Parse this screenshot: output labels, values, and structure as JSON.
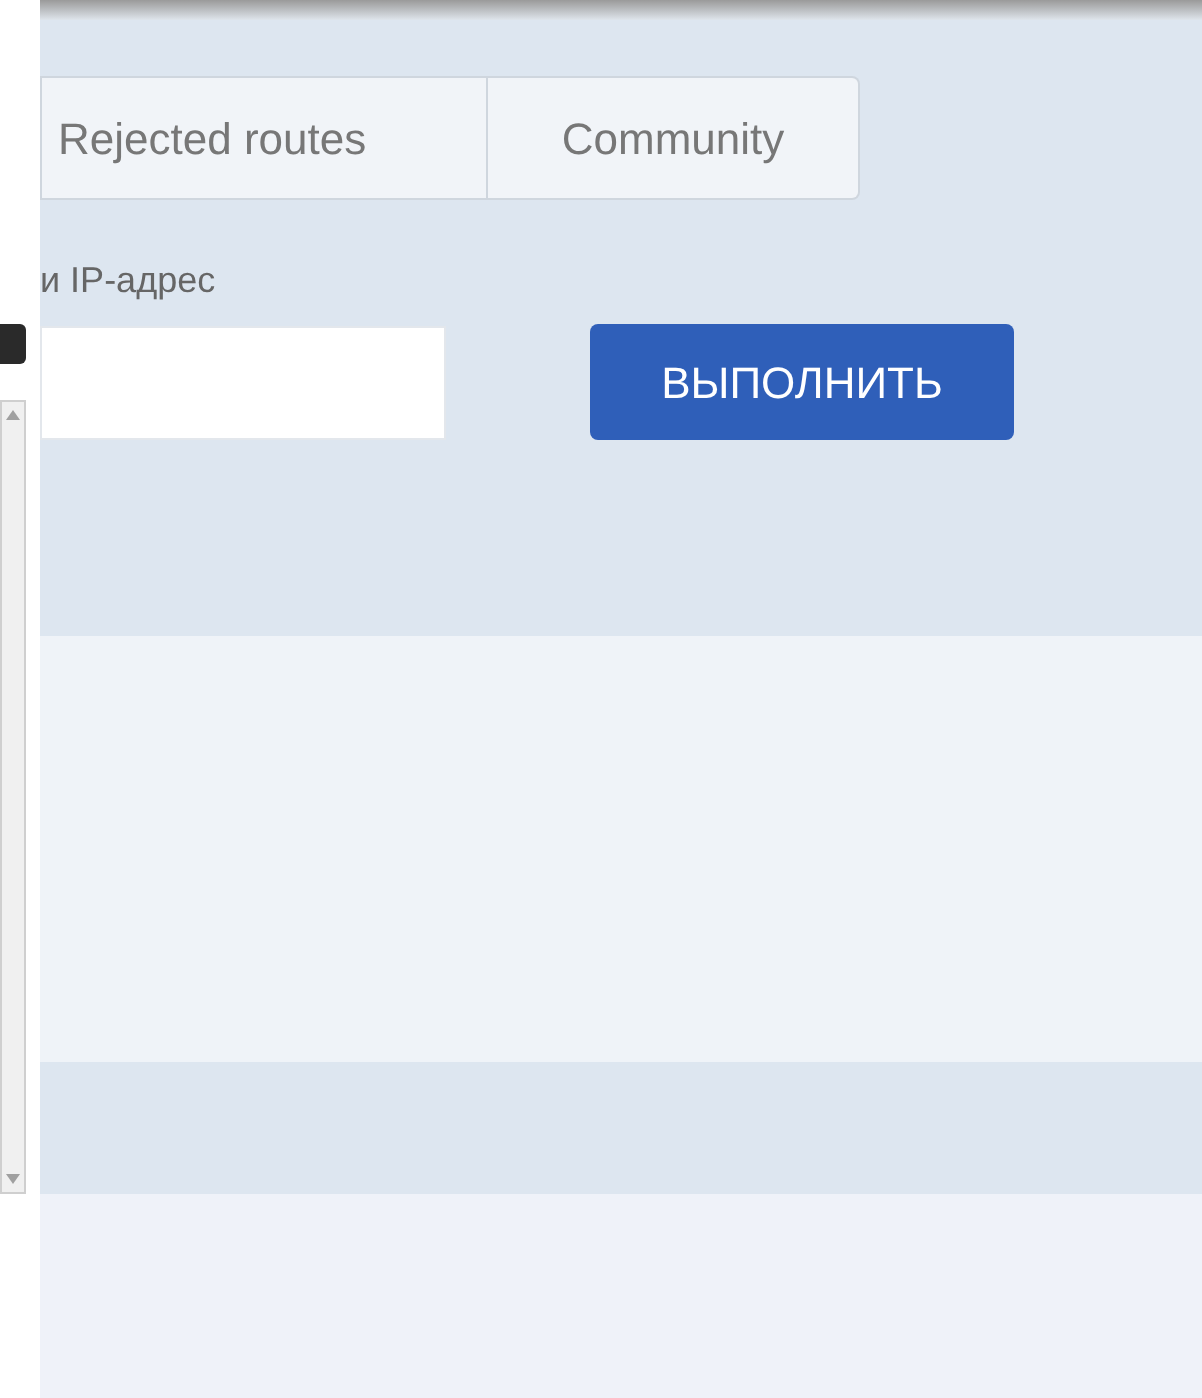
{
  "tabs": [
    {
      "label": "Rejected routes",
      "selected": false
    },
    {
      "label": "Community",
      "selected": false
    }
  ],
  "address_field": {
    "label": "и IP-адрес"
  },
  "run_button": {
    "label": "ВЫПОЛНИТЬ"
  }
}
